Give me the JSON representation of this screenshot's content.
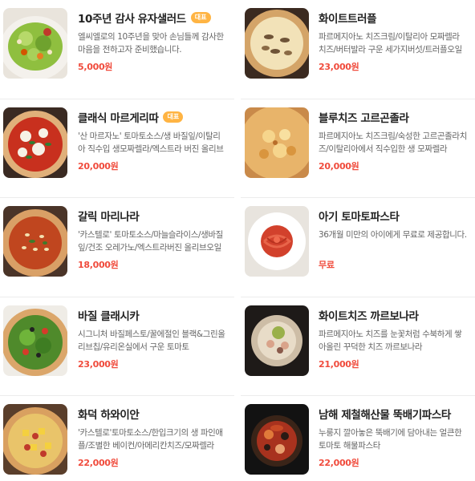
{
  "menu": {
    "left": [
      {
        "name": "10주년 감사 유자샐러드",
        "badge": "대표",
        "desc": "엘씨엘로의 10주년을 맞아 손님들께 감사한 마음을 전하고자 준비했습니다.",
        "price": "5,000원",
        "image": "salad"
      },
      {
        "name": "클래식 마르게리따",
        "badge": "대표",
        "desc": "'산 마르자노' 토마토소스/생 바질잎/이탈리아 직수입 생모짜렐라/엑스트라 버진 올리브오일",
        "price": "20,000원",
        "image": "margherita"
      },
      {
        "name": "갈릭 마리나라",
        "badge": "",
        "desc": "'카스텔로' 토마토소스/마늘슬라이스/생바질잎/건조 오레가노/엑스트라버진 올리브오일",
        "price": "18,000원",
        "image": "marinara"
      },
      {
        "name": "바질 클래시카",
        "badge": "",
        "desc": "시그니처 바질페스토/꿀에절인 블랙&그린올리브칩/유리온실에서 구운 토마토",
        "price": "23,000원",
        "image": "basil-pizza"
      },
      {
        "name": "화덕 하와이안",
        "badge": "",
        "desc": "'카스텔로'토마토소스/한입크기의 생 파인애플/조별한 베이컨/아메리칸치즈/모짜렐라",
        "price": "22,000원",
        "image": "hawaiian"
      }
    ],
    "right": [
      {
        "name": "화이트트러플",
        "badge": "",
        "desc": "파르메지아노 치즈크림/이탈리아 모짜렐라 치즈/버터발라 구운 세가지버섯/트러플오일",
        "price": "23,000원",
        "image": "truffle"
      },
      {
        "name": "블루치즈 고르곤졸라",
        "badge": "",
        "desc": "파르메지아노 치즈크림/숙성한 고르곤졸라치즈/이탈리아에서 직수입한 생 모짜렐라",
        "price": "20,000원",
        "image": "gorgonzola"
      },
      {
        "name": "아기 토마토파스타",
        "badge": "",
        "desc": "36개월 미만의 아이에게 무료로 제공합니다.",
        "price": "무료",
        "image": "kids-pasta"
      },
      {
        "name": "화이트치즈 까르보나라",
        "badge": "",
        "desc": "파르메지아노 치즈를 눈꽃처럼 수북하게 쌓아올린 꾸덕한 치즈 까르보나라",
        "price": "21,000원",
        "image": "carbonara"
      },
      {
        "name": "남해 제철해산물 뚝배기파스타",
        "badge": "",
        "desc": "누룽지 깔아놓은 뚝배기에 담아내는 얼큰한 토마토 해물파스타",
        "price": "22,000원",
        "image": "seafood-pasta"
      }
    ]
  },
  "colors": {
    "price": "#f04b3c",
    "badge": "#ffb443"
  }
}
